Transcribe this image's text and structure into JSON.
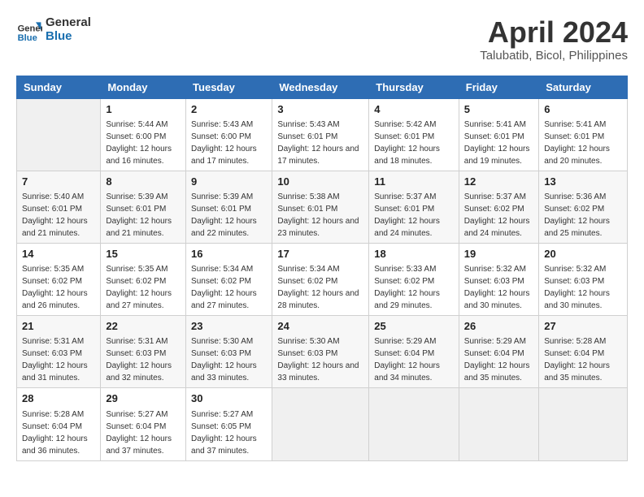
{
  "logo": {
    "line1": "General",
    "line2": "Blue"
  },
  "title": "April 2024",
  "location": "Talubatib, Bicol, Philippines",
  "days_header": [
    "Sunday",
    "Monday",
    "Tuesday",
    "Wednesday",
    "Thursday",
    "Friday",
    "Saturday"
  ],
  "weeks": [
    [
      {
        "day": "",
        "sunrise": "",
        "sunset": "",
        "daylight": ""
      },
      {
        "day": "1",
        "sunrise": "5:44 AM",
        "sunset": "6:00 PM",
        "daylight": "12 hours and 16 minutes."
      },
      {
        "day": "2",
        "sunrise": "5:43 AM",
        "sunset": "6:00 PM",
        "daylight": "12 hours and 17 minutes."
      },
      {
        "day": "3",
        "sunrise": "5:43 AM",
        "sunset": "6:01 PM",
        "daylight": "12 hours and 17 minutes."
      },
      {
        "day": "4",
        "sunrise": "5:42 AM",
        "sunset": "6:01 PM",
        "daylight": "12 hours and 18 minutes."
      },
      {
        "day": "5",
        "sunrise": "5:41 AM",
        "sunset": "6:01 PM",
        "daylight": "12 hours and 19 minutes."
      },
      {
        "day": "6",
        "sunrise": "5:41 AM",
        "sunset": "6:01 PM",
        "daylight": "12 hours and 20 minutes."
      }
    ],
    [
      {
        "day": "7",
        "sunrise": "5:40 AM",
        "sunset": "6:01 PM",
        "daylight": "12 hours and 21 minutes."
      },
      {
        "day": "8",
        "sunrise": "5:39 AM",
        "sunset": "6:01 PM",
        "daylight": "12 hours and 21 minutes."
      },
      {
        "day": "9",
        "sunrise": "5:39 AM",
        "sunset": "6:01 PM",
        "daylight": "12 hours and 22 minutes."
      },
      {
        "day": "10",
        "sunrise": "5:38 AM",
        "sunset": "6:01 PM",
        "daylight": "12 hours and 23 minutes."
      },
      {
        "day": "11",
        "sunrise": "5:37 AM",
        "sunset": "6:01 PM",
        "daylight": "12 hours and 24 minutes."
      },
      {
        "day": "12",
        "sunrise": "5:37 AM",
        "sunset": "6:02 PM",
        "daylight": "12 hours and 24 minutes."
      },
      {
        "day": "13",
        "sunrise": "5:36 AM",
        "sunset": "6:02 PM",
        "daylight": "12 hours and 25 minutes."
      }
    ],
    [
      {
        "day": "14",
        "sunrise": "5:35 AM",
        "sunset": "6:02 PM",
        "daylight": "12 hours and 26 minutes."
      },
      {
        "day": "15",
        "sunrise": "5:35 AM",
        "sunset": "6:02 PM",
        "daylight": "12 hours and 27 minutes."
      },
      {
        "day": "16",
        "sunrise": "5:34 AM",
        "sunset": "6:02 PM",
        "daylight": "12 hours and 27 minutes."
      },
      {
        "day": "17",
        "sunrise": "5:34 AM",
        "sunset": "6:02 PM",
        "daylight": "12 hours and 28 minutes."
      },
      {
        "day": "18",
        "sunrise": "5:33 AM",
        "sunset": "6:02 PM",
        "daylight": "12 hours and 29 minutes."
      },
      {
        "day": "19",
        "sunrise": "5:32 AM",
        "sunset": "6:03 PM",
        "daylight": "12 hours and 30 minutes."
      },
      {
        "day": "20",
        "sunrise": "5:32 AM",
        "sunset": "6:03 PM",
        "daylight": "12 hours and 30 minutes."
      }
    ],
    [
      {
        "day": "21",
        "sunrise": "5:31 AM",
        "sunset": "6:03 PM",
        "daylight": "12 hours and 31 minutes."
      },
      {
        "day": "22",
        "sunrise": "5:31 AM",
        "sunset": "6:03 PM",
        "daylight": "12 hours and 32 minutes."
      },
      {
        "day": "23",
        "sunrise": "5:30 AM",
        "sunset": "6:03 PM",
        "daylight": "12 hours and 33 minutes."
      },
      {
        "day": "24",
        "sunrise": "5:30 AM",
        "sunset": "6:03 PM",
        "daylight": "12 hours and 33 minutes."
      },
      {
        "day": "25",
        "sunrise": "5:29 AM",
        "sunset": "6:04 PM",
        "daylight": "12 hours and 34 minutes."
      },
      {
        "day": "26",
        "sunrise": "5:29 AM",
        "sunset": "6:04 PM",
        "daylight": "12 hours and 35 minutes."
      },
      {
        "day": "27",
        "sunrise": "5:28 AM",
        "sunset": "6:04 PM",
        "daylight": "12 hours and 35 minutes."
      }
    ],
    [
      {
        "day": "28",
        "sunrise": "5:28 AM",
        "sunset": "6:04 PM",
        "daylight": "12 hours and 36 minutes."
      },
      {
        "day": "29",
        "sunrise": "5:27 AM",
        "sunset": "6:04 PM",
        "daylight": "12 hours and 37 minutes."
      },
      {
        "day": "30",
        "sunrise": "5:27 AM",
        "sunset": "6:05 PM",
        "daylight": "12 hours and 37 minutes."
      },
      {
        "day": "",
        "sunrise": "",
        "sunset": "",
        "daylight": ""
      },
      {
        "day": "",
        "sunrise": "",
        "sunset": "",
        "daylight": ""
      },
      {
        "day": "",
        "sunrise": "",
        "sunset": "",
        "daylight": ""
      },
      {
        "day": "",
        "sunrise": "",
        "sunset": "",
        "daylight": ""
      }
    ]
  ]
}
